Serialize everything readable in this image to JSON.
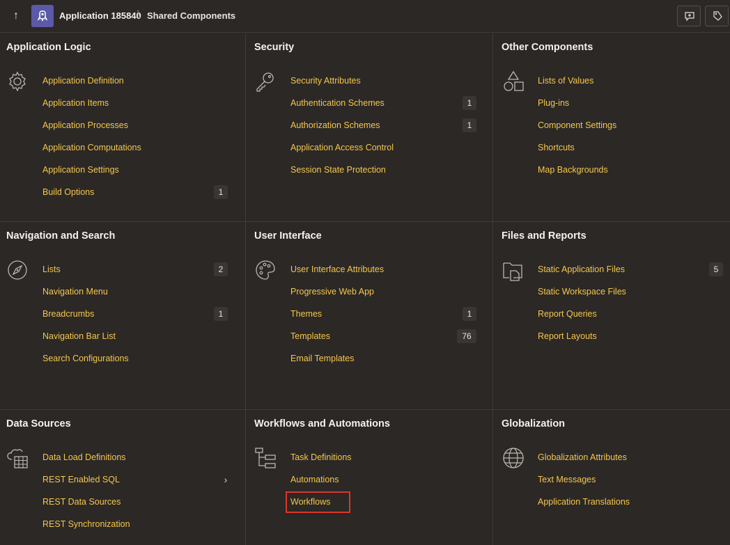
{
  "header": {
    "app_name": "Application 185840",
    "separator": "\\",
    "current_page": "Shared Components"
  },
  "panels": {
    "application_logic": {
      "title": "Application Logic",
      "icon": "gear-icon",
      "items": [
        {
          "label": "Application Definition"
        },
        {
          "label": "Application Items"
        },
        {
          "label": "Application Processes"
        },
        {
          "label": "Application Computations"
        },
        {
          "label": "Application Settings"
        },
        {
          "label": "Build Options",
          "count": "1"
        }
      ]
    },
    "security": {
      "title": "Security",
      "icon": "key-icon",
      "items": [
        {
          "label": "Security Attributes"
        },
        {
          "label": "Authentication Schemes",
          "count": "1"
        },
        {
          "label": "Authorization Schemes",
          "count": "1"
        },
        {
          "label": "Application Access Control"
        },
        {
          "label": "Session State Protection"
        }
      ]
    },
    "other_components": {
      "title": "Other Components",
      "icon": "shapes-icon",
      "items": [
        {
          "label": "Lists of Values"
        },
        {
          "label": "Plug-ins"
        },
        {
          "label": "Component Settings"
        },
        {
          "label": "Shortcuts"
        },
        {
          "label": "Map Backgrounds"
        }
      ]
    },
    "navigation_search": {
      "title": "Navigation and Search",
      "icon": "compass-icon",
      "items": [
        {
          "label": "Lists",
          "count": "2"
        },
        {
          "label": "Navigation Menu"
        },
        {
          "label": "Breadcrumbs",
          "count": "1"
        },
        {
          "label": "Navigation Bar List"
        },
        {
          "label": "Search Configurations"
        }
      ]
    },
    "user_interface": {
      "title": "User Interface",
      "icon": "palette-icon",
      "items": [
        {
          "label": "User Interface Attributes"
        },
        {
          "label": "Progressive Web App"
        },
        {
          "label": "Themes",
          "count": "1"
        },
        {
          "label": "Templates",
          "count": "76"
        },
        {
          "label": "Email Templates"
        }
      ]
    },
    "files_reports": {
      "title": "Files and Reports",
      "icon": "folder-file-icon",
      "items": [
        {
          "label": "Static Application Files",
          "count": "5"
        },
        {
          "label": "Static Workspace Files"
        },
        {
          "label": "Report Queries"
        },
        {
          "label": "Report Layouts"
        }
      ]
    },
    "data_sources": {
      "title": "Data Sources",
      "icon": "cloud-grid-icon",
      "items": [
        {
          "label": "Data Load Definitions"
        },
        {
          "label": "REST Enabled SQL"
        },
        {
          "label": "REST Data Sources"
        },
        {
          "label": "REST Synchronization"
        }
      ]
    },
    "workflows": {
      "title": "Workflows and Automations",
      "icon": "flowchart-icon",
      "items": [
        {
          "label": "Task Definitions"
        },
        {
          "label": "Automations"
        },
        {
          "label": "Workflows"
        }
      ]
    },
    "globalization": {
      "title": "Globalization",
      "icon": "globe-icon",
      "items": [
        {
          "label": "Globalization Attributes"
        },
        {
          "label": "Text Messages"
        },
        {
          "label": "Application Translations"
        }
      ]
    }
  },
  "colors": {
    "background": "#2b2826",
    "link": "#f6c74b",
    "app_icon": "#5b5aa6",
    "highlight": "#e0352b"
  }
}
